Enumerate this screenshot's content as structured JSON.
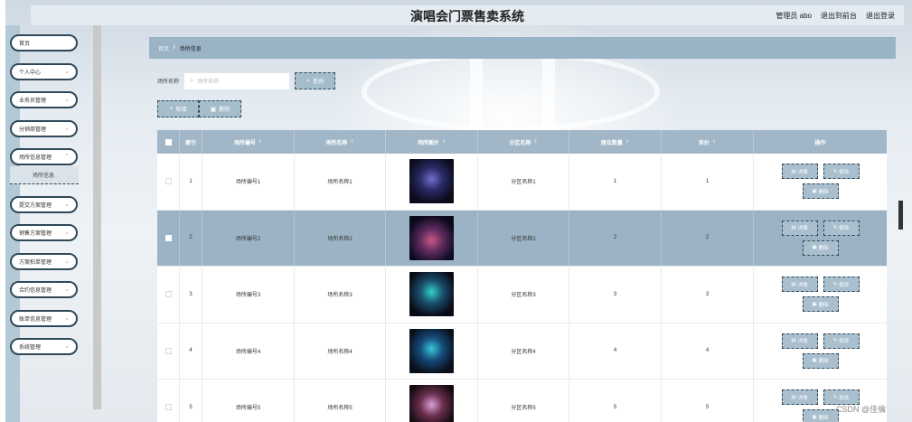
{
  "header": {
    "title": "演唱会门票售卖系统",
    "admin": "管理员 abo",
    "to_front": "退出到前台",
    "logout": "退出登录"
  },
  "sidebar": {
    "items": [
      {
        "label": "首页"
      },
      {
        "label": "个人中心"
      },
      {
        "label": "业务员管理"
      },
      {
        "label": "分销商管理"
      },
      {
        "label": "场所信息管理"
      },
      {
        "label": "提交方案管理"
      },
      {
        "label": "销售方案管理"
      },
      {
        "label": "方案拍单管理"
      },
      {
        "label": "合约信息管理"
      },
      {
        "label": "账单信息管理"
      },
      {
        "label": "系统管理"
      }
    ],
    "submenu": {
      "label": "场所信息"
    }
  },
  "breadcrumb": {
    "home": "首页",
    "separator": "/",
    "current": "场所信息"
  },
  "search": {
    "label": "场所名称",
    "placeholder": "场所名称",
    "button": "查询"
  },
  "actions": {
    "add": "新增",
    "delete": "删除"
  },
  "table": {
    "columns": [
      "索引",
      "场所编号",
      "场所名称",
      "场所图片",
      "分区名称",
      "座位数量",
      "单价",
      "操作"
    ],
    "rows": [
      {
        "index": "1",
        "code": "场所编号1",
        "name": "场所名称1",
        "zone": "分区名称1",
        "seats": "1",
        "price": "1"
      },
      {
        "index": "2",
        "code": "场所编号2",
        "name": "场所名称2",
        "zone": "分区名称2",
        "seats": "2",
        "price": "2"
      },
      {
        "index": "3",
        "code": "场所编号3",
        "name": "场所名称3",
        "zone": "分区名称3",
        "seats": "3",
        "price": "3"
      },
      {
        "index": "4",
        "code": "场所编号4",
        "name": "场所名称4",
        "zone": "分区名称4",
        "seats": "4",
        "price": "4"
      },
      {
        "index": "5",
        "code": "场所编号5",
        "name": "场所名称5",
        "zone": "分区名称5",
        "seats": "5",
        "price": "5"
      }
    ],
    "ops": {
      "detail": "详情",
      "edit": "修改",
      "delete": "删除"
    }
  },
  "watermark": "CSDN @佳倫",
  "colors": {
    "accent": "#9ab3c5",
    "border_dark": "#2f4859",
    "header_row": "#a1b7c7",
    "selected_row": "#9bb3c4"
  }
}
